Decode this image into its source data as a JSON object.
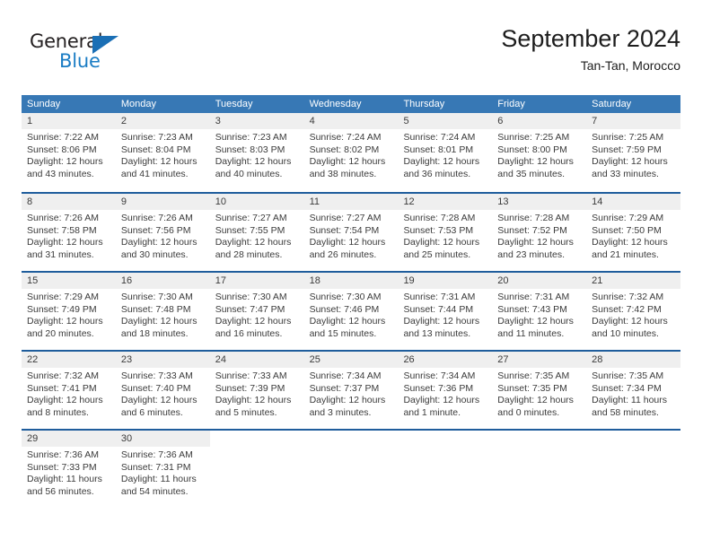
{
  "brand": {
    "name_part1": "General",
    "name_part2": "Blue",
    "triangle_color": "#1a6fb5",
    "blue_text_color": "#1a7cc4"
  },
  "header": {
    "month_title": "September 2024",
    "location": "Tan-Tan, Morocco"
  },
  "theme": {
    "header_blue": "#3778b5",
    "week_divider_blue": "#1f5d9c",
    "day_band_gray": "#efefef"
  },
  "calendar": {
    "weekdays": [
      "Sunday",
      "Monday",
      "Tuesday",
      "Wednesday",
      "Thursday",
      "Friday",
      "Saturday"
    ],
    "weeks": [
      [
        {
          "day": "1",
          "lines": [
            "Sunrise: 7:22 AM",
            "Sunset: 8:06 PM",
            "Daylight: 12 hours",
            "and 43 minutes."
          ]
        },
        {
          "day": "2",
          "lines": [
            "Sunrise: 7:23 AM",
            "Sunset: 8:04 PM",
            "Daylight: 12 hours",
            "and 41 minutes."
          ]
        },
        {
          "day": "3",
          "lines": [
            "Sunrise: 7:23 AM",
            "Sunset: 8:03 PM",
            "Daylight: 12 hours",
            "and 40 minutes."
          ]
        },
        {
          "day": "4",
          "lines": [
            "Sunrise: 7:24 AM",
            "Sunset: 8:02 PM",
            "Daylight: 12 hours",
            "and 38 minutes."
          ]
        },
        {
          "day": "5",
          "lines": [
            "Sunrise: 7:24 AM",
            "Sunset: 8:01 PM",
            "Daylight: 12 hours",
            "and 36 minutes."
          ]
        },
        {
          "day": "6",
          "lines": [
            "Sunrise: 7:25 AM",
            "Sunset: 8:00 PM",
            "Daylight: 12 hours",
            "and 35 minutes."
          ]
        },
        {
          "day": "7",
          "lines": [
            "Sunrise: 7:25 AM",
            "Sunset: 7:59 PM",
            "Daylight: 12 hours",
            "and 33 minutes."
          ]
        }
      ],
      [
        {
          "day": "8",
          "lines": [
            "Sunrise: 7:26 AM",
            "Sunset: 7:58 PM",
            "Daylight: 12 hours",
            "and 31 minutes."
          ]
        },
        {
          "day": "9",
          "lines": [
            "Sunrise: 7:26 AM",
            "Sunset: 7:56 PM",
            "Daylight: 12 hours",
            "and 30 minutes."
          ]
        },
        {
          "day": "10",
          "lines": [
            "Sunrise: 7:27 AM",
            "Sunset: 7:55 PM",
            "Daylight: 12 hours",
            "and 28 minutes."
          ]
        },
        {
          "day": "11",
          "lines": [
            "Sunrise: 7:27 AM",
            "Sunset: 7:54 PM",
            "Daylight: 12 hours",
            "and 26 minutes."
          ]
        },
        {
          "day": "12",
          "lines": [
            "Sunrise: 7:28 AM",
            "Sunset: 7:53 PM",
            "Daylight: 12 hours",
            "and 25 minutes."
          ]
        },
        {
          "day": "13",
          "lines": [
            "Sunrise: 7:28 AM",
            "Sunset: 7:52 PM",
            "Daylight: 12 hours",
            "and 23 minutes."
          ]
        },
        {
          "day": "14",
          "lines": [
            "Sunrise: 7:29 AM",
            "Sunset: 7:50 PM",
            "Daylight: 12 hours",
            "and 21 minutes."
          ]
        }
      ],
      [
        {
          "day": "15",
          "lines": [
            "Sunrise: 7:29 AM",
            "Sunset: 7:49 PM",
            "Daylight: 12 hours",
            "and 20 minutes."
          ]
        },
        {
          "day": "16",
          "lines": [
            "Sunrise: 7:30 AM",
            "Sunset: 7:48 PM",
            "Daylight: 12 hours",
            "and 18 minutes."
          ]
        },
        {
          "day": "17",
          "lines": [
            "Sunrise: 7:30 AM",
            "Sunset: 7:47 PM",
            "Daylight: 12 hours",
            "and 16 minutes."
          ]
        },
        {
          "day": "18",
          "lines": [
            "Sunrise: 7:30 AM",
            "Sunset: 7:46 PM",
            "Daylight: 12 hours",
            "and 15 minutes."
          ]
        },
        {
          "day": "19",
          "lines": [
            "Sunrise: 7:31 AM",
            "Sunset: 7:44 PM",
            "Daylight: 12 hours",
            "and 13 minutes."
          ]
        },
        {
          "day": "20",
          "lines": [
            "Sunrise: 7:31 AM",
            "Sunset: 7:43 PM",
            "Daylight: 12 hours",
            "and 11 minutes."
          ]
        },
        {
          "day": "21",
          "lines": [
            "Sunrise: 7:32 AM",
            "Sunset: 7:42 PM",
            "Daylight: 12 hours",
            "and 10 minutes."
          ]
        }
      ],
      [
        {
          "day": "22",
          "lines": [
            "Sunrise: 7:32 AM",
            "Sunset: 7:41 PM",
            "Daylight: 12 hours",
            "and 8 minutes."
          ]
        },
        {
          "day": "23",
          "lines": [
            "Sunrise: 7:33 AM",
            "Sunset: 7:40 PM",
            "Daylight: 12 hours",
            "and 6 minutes."
          ]
        },
        {
          "day": "24",
          "lines": [
            "Sunrise: 7:33 AM",
            "Sunset: 7:39 PM",
            "Daylight: 12 hours",
            "and 5 minutes."
          ]
        },
        {
          "day": "25",
          "lines": [
            "Sunrise: 7:34 AM",
            "Sunset: 7:37 PM",
            "Daylight: 12 hours",
            "and 3 minutes."
          ]
        },
        {
          "day": "26",
          "lines": [
            "Sunrise: 7:34 AM",
            "Sunset: 7:36 PM",
            "Daylight: 12 hours",
            "and 1 minute."
          ]
        },
        {
          "day": "27",
          "lines": [
            "Sunrise: 7:35 AM",
            "Sunset: 7:35 PM",
            "Daylight: 12 hours",
            "and 0 minutes."
          ]
        },
        {
          "day": "28",
          "lines": [
            "Sunrise: 7:35 AM",
            "Sunset: 7:34 PM",
            "Daylight: 11 hours",
            "and 58 minutes."
          ]
        }
      ],
      [
        {
          "day": "29",
          "lines": [
            "Sunrise: 7:36 AM",
            "Sunset: 7:33 PM",
            "Daylight: 11 hours",
            "and 56 minutes."
          ]
        },
        {
          "day": "30",
          "lines": [
            "Sunrise: 7:36 AM",
            "Sunset: 7:31 PM",
            "Daylight: 11 hours",
            "and 54 minutes."
          ]
        },
        {
          "day": "",
          "lines": []
        },
        {
          "day": "",
          "lines": []
        },
        {
          "day": "",
          "lines": []
        },
        {
          "day": "",
          "lines": []
        },
        {
          "day": "",
          "lines": []
        }
      ]
    ]
  }
}
